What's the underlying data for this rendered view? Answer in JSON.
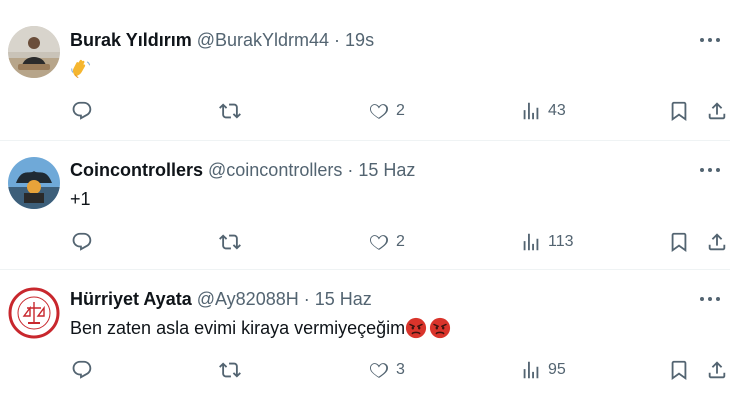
{
  "tweets": [
    {
      "name": "Burak Yıldırım",
      "handle": "@BurakYldrm44",
      "separator": "·",
      "time": "19s",
      "text": "",
      "emoji": [
        "waving-hands"
      ],
      "reply_count": "",
      "retweet_count": "",
      "like_count": "2",
      "view_count": "43"
    },
    {
      "name": "Coincontrollers",
      "handle": "@coincontrollers",
      "separator": "·",
      "time": "15 Haz",
      "text": "+1",
      "emoji": [],
      "reply_count": "",
      "retweet_count": "",
      "like_count": "2",
      "view_count": "113"
    },
    {
      "name": "Hürriyet Ayata",
      "handle": "@Ay82088H",
      "separator": "·",
      "time": "15 Haz",
      "text": "Ben zaten asla evimi kiraya vermiyeçeğim",
      "emoji": [
        "angry-face",
        "angry-face"
      ],
      "reply_count": "",
      "retweet_count": "",
      "like_count": "3",
      "view_count": "95"
    }
  ],
  "colors": {
    "text": "#0f1419",
    "secondary": "#536471",
    "divider": "#eff3f4",
    "angry": "#d9342b"
  },
  "icons": [
    "reply-icon",
    "retweet-icon",
    "heart-icon",
    "views-icon",
    "bookmark-icon",
    "share-icon",
    "more-icon"
  ]
}
